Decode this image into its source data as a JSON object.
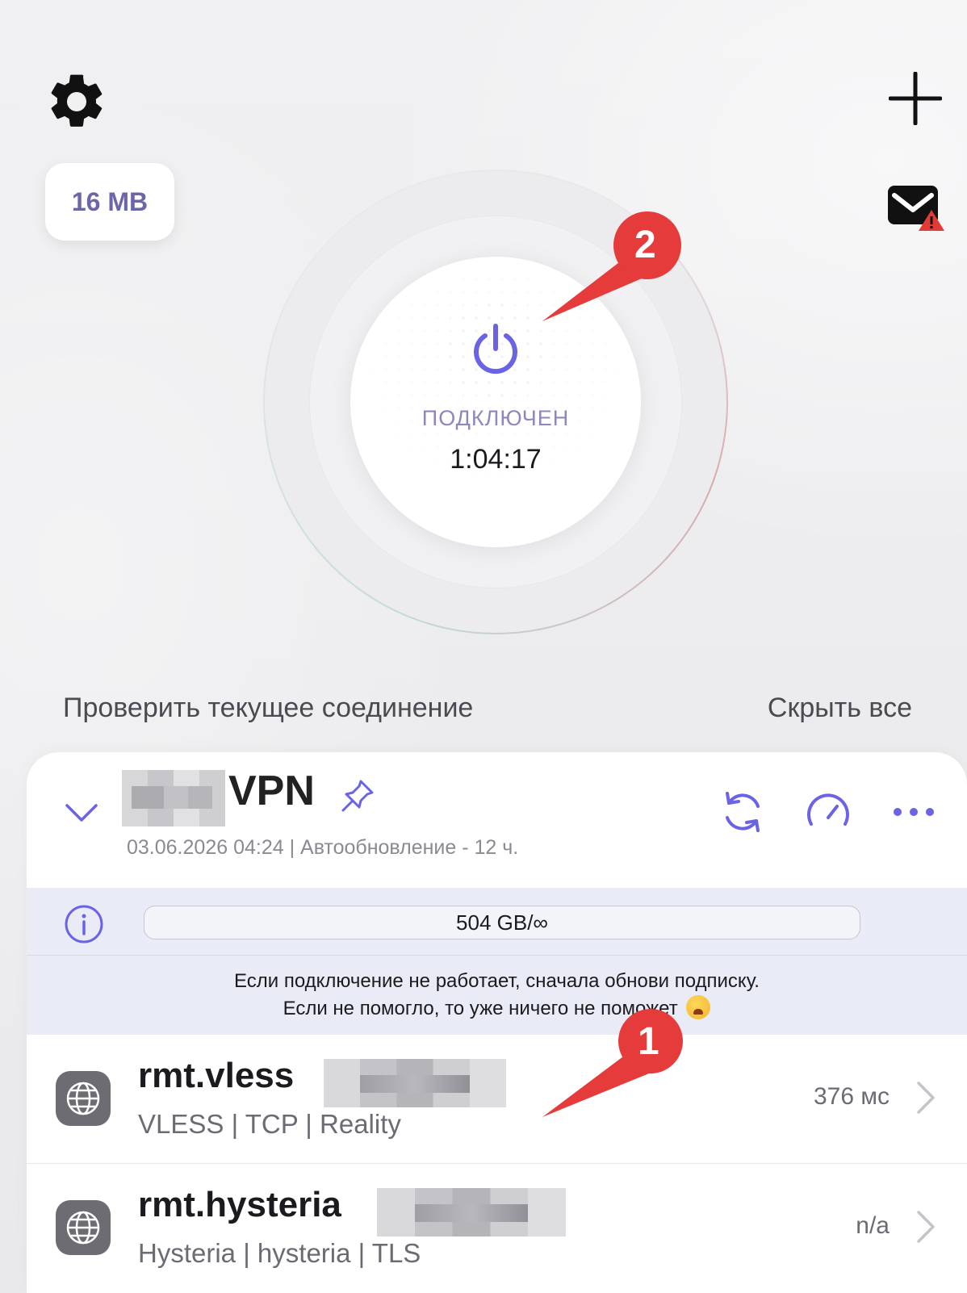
{
  "traffic_chip": "16 MB",
  "connection": {
    "status": "ПОДКЛЮЧЕН",
    "timer": "1:04:17"
  },
  "annotations": {
    "arrow_1": "1",
    "arrow_2": "2"
  },
  "links": {
    "check_connection": "Проверить текущее соединение",
    "hide_all": "Скрыть все"
  },
  "subscription": {
    "title": "VPN",
    "meta": "03.06.2026 04:24 | Автообновление - 12 ч.",
    "quota": "504 GB/∞",
    "notice_line1": "Если подключение не работает, сначала обнови подписку.",
    "notice_line2": "Если не помогло, то уже ничего не поможет"
  },
  "servers": [
    {
      "name": "rmt.vless",
      "protocol": "VLESS | TCP | Reality",
      "ping": "376 мс"
    },
    {
      "name": "rmt.hysteria",
      "protocol": "Hysteria | hysteria | TLS",
      "ping": "n/a"
    }
  ],
  "icons": {
    "settings": "gear-icon",
    "add": "plus-icon",
    "mail": "mail-warning-icon",
    "power": "power-icon",
    "expand": "chevron-down-icon",
    "pin": "pin-icon",
    "refresh": "refresh-icon",
    "speed": "speedometer-icon",
    "more": "more-icon",
    "info": "info-icon",
    "server": "globe-icon",
    "open": "chevron-right-icon"
  },
  "colors": {
    "accent": "#6a63e6",
    "status_text": "#8c88bd",
    "arrow_red": "#e63b3b",
    "info_band": "#e9ebf6"
  }
}
